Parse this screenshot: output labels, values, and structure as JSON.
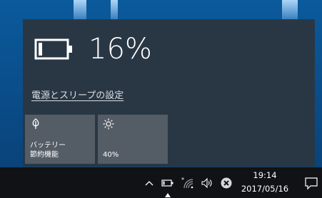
{
  "battery": {
    "percent_text": "16%",
    "level": 0.16
  },
  "settings_link": "電源とスリープの設定",
  "tiles": [
    {
      "label": "バッテリー\n節約機能",
      "icon": "leaf-icon"
    },
    {
      "label": "40%",
      "icon": "brightness-icon"
    }
  ],
  "taskbar": {
    "time": "19:14",
    "date": "2017/05/16",
    "tray_icons": [
      "chevron-up-icon",
      "battery-icon",
      "wifi-icon",
      "volume-icon",
      "error-icon",
      "action-center-icon"
    ]
  },
  "colors": {
    "flyout_bg": "#2b3642",
    "tile_bg": "#545c65",
    "taskbar_bg": "#101216",
    "wallpaper": "#0a4f8d"
  }
}
